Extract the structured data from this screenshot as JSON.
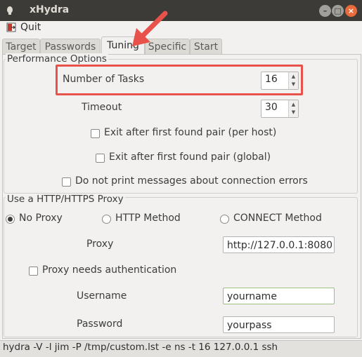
{
  "window": {
    "title": "xHydra"
  },
  "menu": {
    "quit_label": "Quit"
  },
  "tabs": [
    {
      "label": "Target",
      "active": false
    },
    {
      "label": "Passwords",
      "active": false
    },
    {
      "label": "Tuning",
      "active": true
    },
    {
      "label": "Specific",
      "active": false
    },
    {
      "label": "Start",
      "active": false
    }
  ],
  "performance": {
    "title": "Performance Options",
    "tasks_label": "Number of Tasks",
    "tasks_value": "16",
    "timeout_label": "Timeout",
    "timeout_value": "30",
    "exit_per_host": "Exit after first found pair (per host)",
    "exit_global": "Exit after first found pair (global)",
    "no_conn_errors": "Do not print messages about connection errors"
  },
  "proxy": {
    "title": "Use a HTTP/HTTPS Proxy",
    "no_proxy": "No Proxy",
    "http_method": "HTTP Method",
    "connect_method": "CONNECT Method",
    "proxy_label": "Proxy",
    "proxy_value": "http://127.0.0.1:8080",
    "needs_auth": "Proxy needs authentication",
    "username_label": "Username",
    "username_value": "yourname",
    "password_label": "Password",
    "password_value": "yourpass"
  },
  "status": {
    "command": "hydra -V -l jim -P /tmp/custom.lst -e ns -t 16 127.0.0.1 ssh"
  },
  "colors": {
    "highlight": "#e8524a",
    "close_button": "#e96b3c",
    "titlebar": "#3c3b37"
  },
  "icons": {
    "app": "app-icon",
    "quit": "quit-icon",
    "arrow": "annotation-arrow-icon"
  }
}
